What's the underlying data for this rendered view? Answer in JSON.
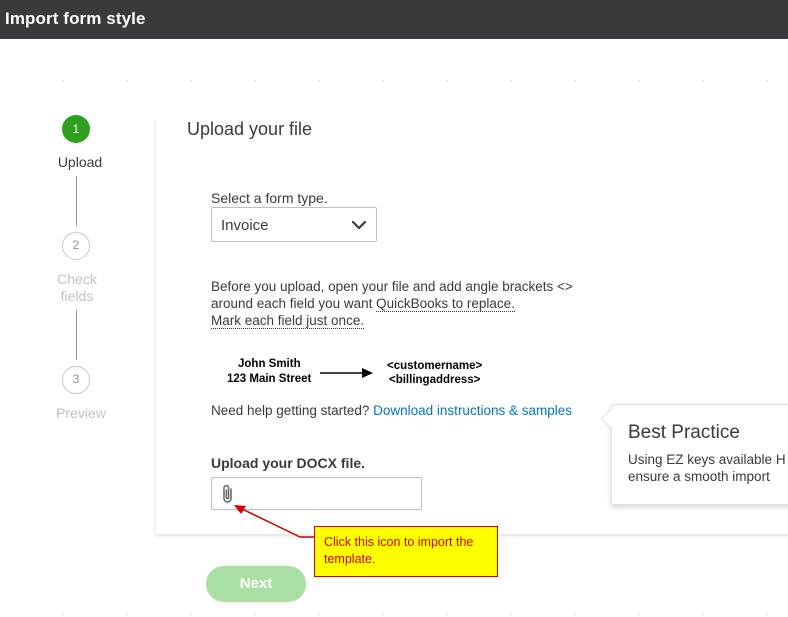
{
  "window": {
    "title": "Import form style"
  },
  "steps": [
    {
      "number": "1",
      "label": "Upload",
      "state": "active"
    },
    {
      "number": "2",
      "label_line1": "Check",
      "label_line2": "fields",
      "state": "inactive"
    },
    {
      "number": "3",
      "label": "Preview",
      "state": "inactive"
    }
  ],
  "main": {
    "heading": "Upload your file",
    "form_type_label": "Select a form type.",
    "form_type_value": "Invoice",
    "desc_line1": "Before you upload, open your file and add angle brackets <>",
    "desc_line2_pre": "around each field you want ",
    "desc_line2_link": "QuickBooks to replace.",
    "desc_line3": "Mark each field just once.",
    "example": {
      "left_line1": "John Smith",
      "left_line2": "123 Main Street",
      "right_line1": "<customername>",
      "right_line2": "<billingaddress>"
    },
    "help_text": "Need help getting started?",
    "help_link": "Download instructions & samples",
    "upload_label": "Upload your DOCX file.",
    "next_label": "Next"
  },
  "popover": {
    "title": "Best Practice",
    "body_line1": "Using EZ keys available H",
    "body_line2": "ensure a smooth import"
  },
  "callout": {
    "text": "Click this icon to import the template."
  },
  "colors": {
    "titlebar": "#393a3d",
    "accent_green": "#2ca01c",
    "next_disabled": "#a9dfa2",
    "link": "#0077c5",
    "callout_bg": "#ffff00",
    "callout_red": "#d40000"
  },
  "icons": {
    "select_chevron": "chevron-down-icon",
    "upload": "paperclip-icon",
    "example_arrow": "arrow-right-icon"
  }
}
